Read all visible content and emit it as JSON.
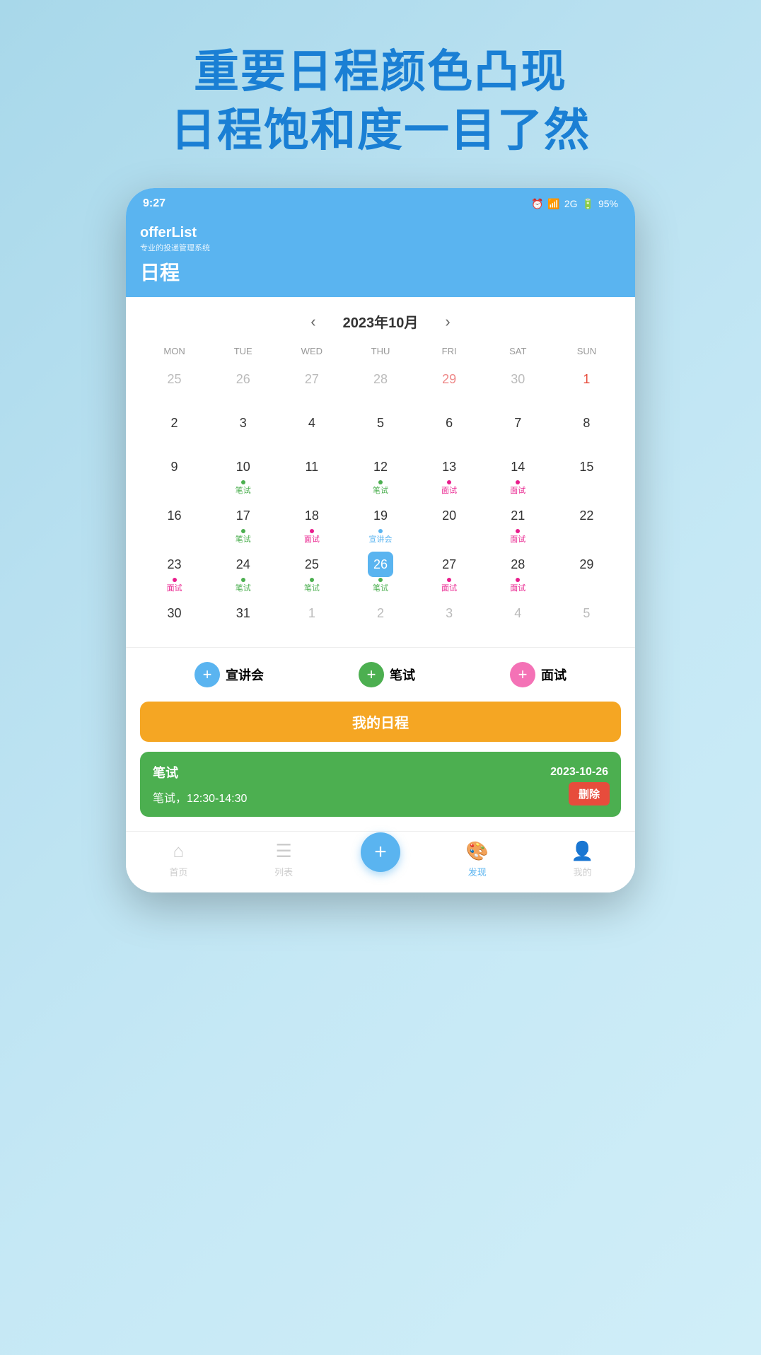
{
  "page": {
    "bg_title_line1": "重要日程颜色凸现",
    "bg_title_line2": "日程饱和度一目了然"
  },
  "status_bar": {
    "time": "9:27",
    "battery": "95%"
  },
  "app": {
    "brand": "offerList",
    "subtitle": "专业的投递管理系统",
    "page_title": "日程"
  },
  "calendar": {
    "nav_prev": "‹",
    "nav_next": "›",
    "month_title": "2023年10月",
    "weekdays": [
      "MON",
      "TUE",
      "WED",
      "THU",
      "FRI",
      "SAT",
      "SUN"
    ]
  },
  "action_buttons": [
    {
      "label": "宣讲会",
      "color": "blue"
    },
    {
      "label": "笔试",
      "color": "green"
    },
    {
      "label": "面试",
      "color": "pink"
    }
  ],
  "schedule": {
    "header": "我的日程",
    "card": {
      "type": "笔试",
      "date": "2023-10-26",
      "detail": "笔试，12:30-14:30",
      "delete_label": "删除"
    }
  },
  "bottom_nav": [
    {
      "label": "首页",
      "active": false
    },
    {
      "label": "列表",
      "active": false
    },
    {
      "label": "",
      "is_add": true
    },
    {
      "label": "发现",
      "active": true
    },
    {
      "label": "我的",
      "active": false
    }
  ]
}
